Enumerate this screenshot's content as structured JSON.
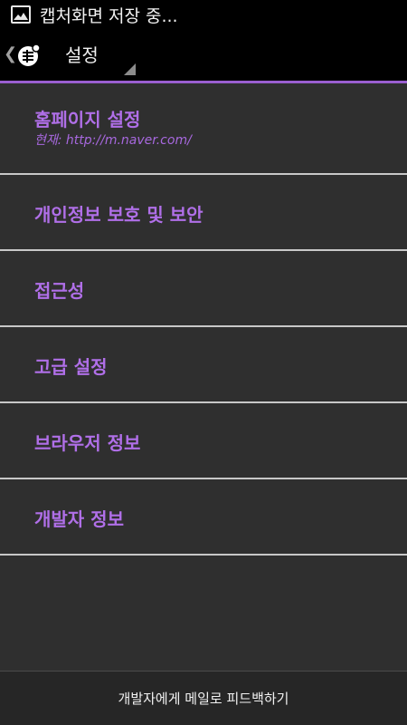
{
  "status_bar": {
    "notification_icon": "image-icon",
    "notification_text": "캡처화면 저장 중..."
  },
  "action_bar": {
    "up_icon": "chevron-left-icon",
    "app_icon": "browser-app-icon",
    "title": "설정"
  },
  "settings": [
    {
      "title": "홈페이지 설정",
      "summary": "현재: http://m.naver.com/"
    },
    {
      "title": "개인정보 보호 및 보안"
    },
    {
      "title": "접근성"
    },
    {
      "title": "고급 설정"
    },
    {
      "title": "브라우저 정보"
    },
    {
      "title": "개발자 정보"
    }
  ],
  "footer": {
    "feedback_label": "개발자에게 메일로 피드백하기"
  },
  "colors": {
    "accent": "#b06fe8",
    "background": "#2f2f2f",
    "bar": "#000000",
    "divider": "#c8c8c8"
  }
}
